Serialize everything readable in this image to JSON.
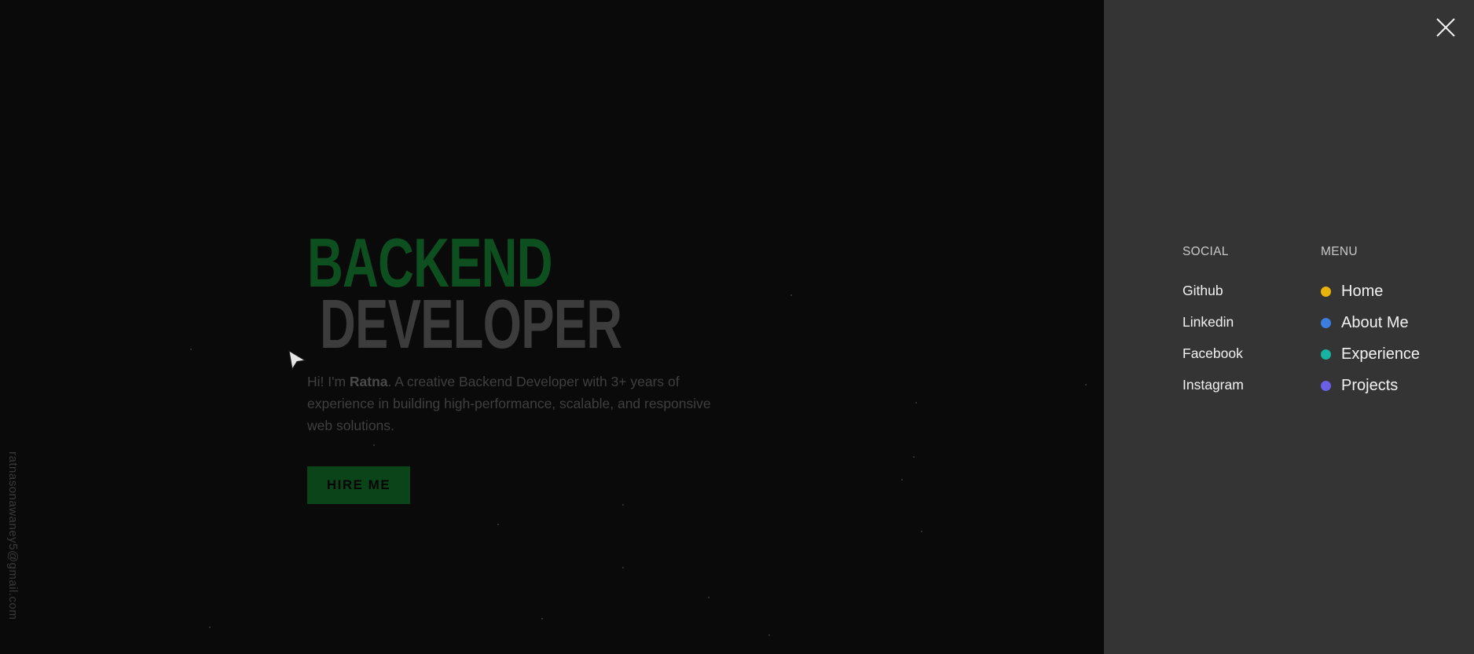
{
  "hero": {
    "title_line1": "BACKEND",
    "title_line2": "DEVELOPER",
    "intro_prefix": "Hi! I'm ",
    "intro_name": "Ratna",
    "intro_suffix": ". A creative Backend Developer with 3+ years of experience in building high-performance, scalable, and responsive web solutions.",
    "cta_label": "HIRE ME"
  },
  "side_email": "ratnasonawaney5@gmail.com",
  "nav_panel": {
    "social_heading": "SOCIAL",
    "menu_heading": "MENU",
    "social_links": [
      {
        "label": "Github"
      },
      {
        "label": "Linkedin"
      },
      {
        "label": "Facebook"
      },
      {
        "label": "Instagram"
      }
    ],
    "menu_items": [
      {
        "label": "Home",
        "dot_color": "#e8b40c"
      },
      {
        "label": "About Me",
        "dot_color": "#3b7ee0"
      },
      {
        "label": "Experience",
        "dot_color": "#17b3a0"
      },
      {
        "label": "Projects",
        "dot_color": "#6b5fe6"
      }
    ]
  },
  "colors": {
    "accent_green": "#0d4f1e",
    "panel_bg": "#343434",
    "page_bg": "#0a0a0a"
  },
  "icons": {
    "close": "close-icon",
    "cursor": "pointer-cursor-icon"
  }
}
